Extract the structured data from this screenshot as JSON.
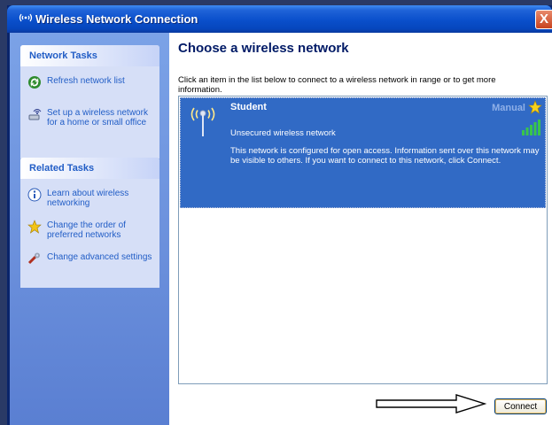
{
  "window": {
    "title": "Wireless Network Connection",
    "close_label": "X",
    "title_icon_text": "((•))"
  },
  "sidebar": {
    "network_tasks": {
      "title": "Network Tasks",
      "items": [
        {
          "label": "Refresh network list",
          "icon": "refresh-icon"
        },
        {
          "label": "Set up a wireless network for a home or small office",
          "icon": "setup-wireless-icon"
        }
      ]
    },
    "related_tasks": {
      "title": "Related Tasks",
      "items": [
        {
          "label": "Learn about wireless networking",
          "icon": "info-icon"
        },
        {
          "label": "Change the order of preferred networks",
          "icon": "star-icon"
        },
        {
          "label": "Change advanced settings",
          "icon": "settings-icon"
        }
      ]
    }
  },
  "main": {
    "heading": "Choose a wireless network",
    "instructions": "Click an item in the list below to connect to a wireless network in range or to get more information.",
    "networks": [
      {
        "name": "Student",
        "mode": "Manual",
        "security": "Unsecured wireless network",
        "description": "This network is configured for open access. Information sent over this network may be visible to others. If you want to connect to this network, click Connect.",
        "signal_bars": 5,
        "selected": true
      }
    ],
    "connect_label": "Connect"
  },
  "colors": {
    "title_bar": "#0a4fcb",
    "sidebar": "#6b90dc",
    "panel": "#d6dff7",
    "selection": "#316ac5",
    "link": "#215dc6",
    "heading": "#001a66"
  }
}
